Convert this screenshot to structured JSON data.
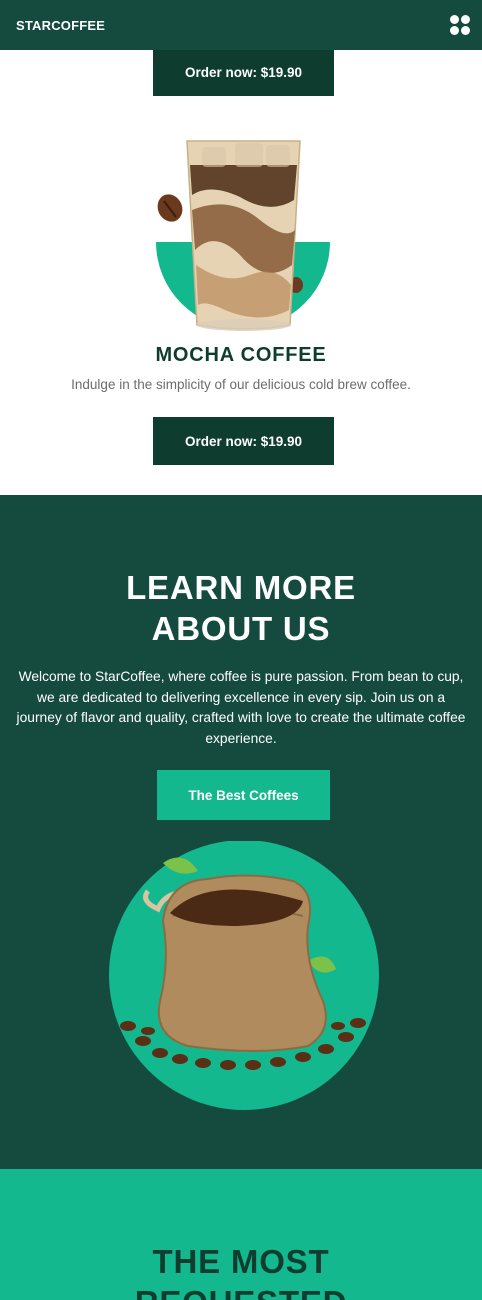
{
  "nav": {
    "brand": "STARCOFFEE",
    "menu_icon": "grid-menu-icon"
  },
  "products": {
    "previous_order_label": "Order now: $19.90",
    "current": {
      "name": "MOCHA COFFEE",
      "description": "Indulge in the simplicity of our delicious cold brew coffee.",
      "order_label": "Order now: $19.90",
      "image_icon": "iced-coffee-glass-icon"
    }
  },
  "about": {
    "title_line1": "LEARN MORE",
    "title_line2": "ABOUT US",
    "text": "Welcome to StarCoffee, where coffee is pure passion. From bean to cup, we are dedicated to delivering excellence in every sip. Join us on a journey of flavor and quality, crafted with love to create the ultimate coffee experience.",
    "button_label": "The Best Coffees",
    "image_icon": "coffee-bean-sack-icon"
  },
  "requested": {
    "title_line1": "THE MOST",
    "title_line2": "REQUESTED"
  },
  "colors": {
    "dark_green": "#154b3f",
    "accent_green": "#13b88f",
    "button_dark": "#0e3d2f"
  }
}
